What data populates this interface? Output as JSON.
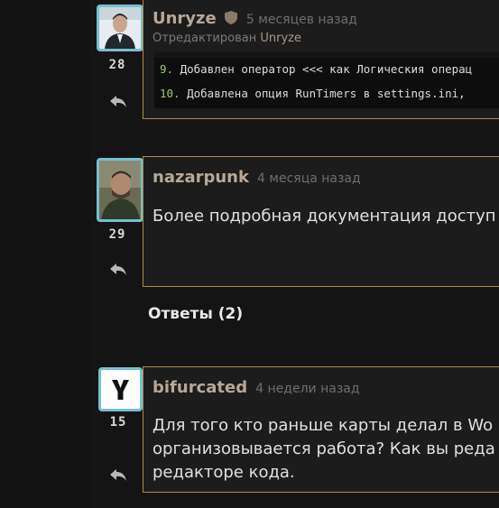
{
  "comments": [
    {
      "author": "Unryze",
      "time": "5 месяцев назад",
      "edited_prefix": "Отредактирован",
      "edited_by": "Unryze",
      "score": "28",
      "code_lines": [
        {
          "num": "9.",
          "text": "Добавлен оператор <<< как Логическия операц"
        },
        {
          "num": "10.",
          "text": "Добавлена опция RunTimers в settings.ini,"
        }
      ]
    },
    {
      "author": "nazarpunk",
      "time": "4 месяца назад",
      "score": "29",
      "text": "Более подробная документация доступ"
    },
    {
      "author": "bifurcated",
      "time": "4 недели назад",
      "score": "15",
      "text_lines": [
        "Для того кто раньше карты делал в Wo",
        "организовывается работа? Как вы реда",
        "редакторе кода."
      ]
    }
  ],
  "answers_label": "Ответы (2)",
  "colors": {
    "accent_border": "#b08a48",
    "avatar_border": "#74c0d0",
    "code_number": "#9ccc65"
  },
  "icons": [
    "shield-icon",
    "reply-icon",
    "fork-logo-icon"
  ]
}
